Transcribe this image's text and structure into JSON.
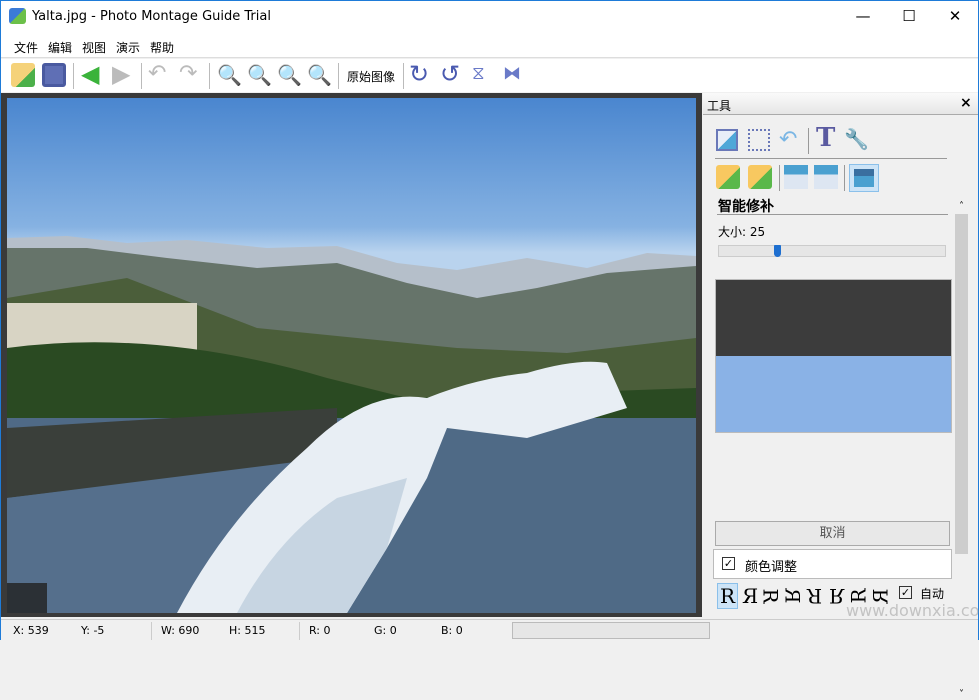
{
  "window": {
    "title": "Yalta.jpg - Photo Montage Guide Trial",
    "minimize": "—",
    "maximize": "☐",
    "close": "✕"
  },
  "menu": [
    "文件",
    "编辑",
    "视图",
    "演示",
    "帮助"
  ],
  "toolbar": {
    "original_image_label": "原始图像",
    "icons": [
      "open-icon",
      "save-icon",
      "back-arrow-icon",
      "forward-arrow-icon",
      "undo-icon",
      "redo-icon",
      "zoom-in-icon",
      "zoom-out-icon",
      "zoom-fit-icon",
      "zoom-actual-icon",
      "rotate-cw-icon",
      "rotate-ccw-icon",
      "flip-vertical-icon",
      "flip-horizontal-icon"
    ]
  },
  "panel": {
    "title": "工具",
    "close": "×",
    "section_title": "智能修补",
    "size_label": "大小: 25",
    "size_value": 25,
    "size_max": 100,
    "cancel_label": "取消",
    "color_adjust_label": "颜色调整",
    "color_adjust_checked": true,
    "auto_label": "自动",
    "auto_checked": true,
    "orientations": [
      "R",
      "Я",
      "R",
      "R",
      "R",
      "R",
      "R",
      "R"
    ],
    "preview_colors": {
      "top": "#3c3c3c",
      "bottom": "#8ab2e6"
    }
  },
  "status": {
    "x": "X: 539",
    "y": "Y: -5",
    "w": "W: 690",
    "h": "H: 515",
    "r": "R: 0",
    "g": "G: 0",
    "b": "B: 0"
  },
  "watermark": "www.downxia.com"
}
